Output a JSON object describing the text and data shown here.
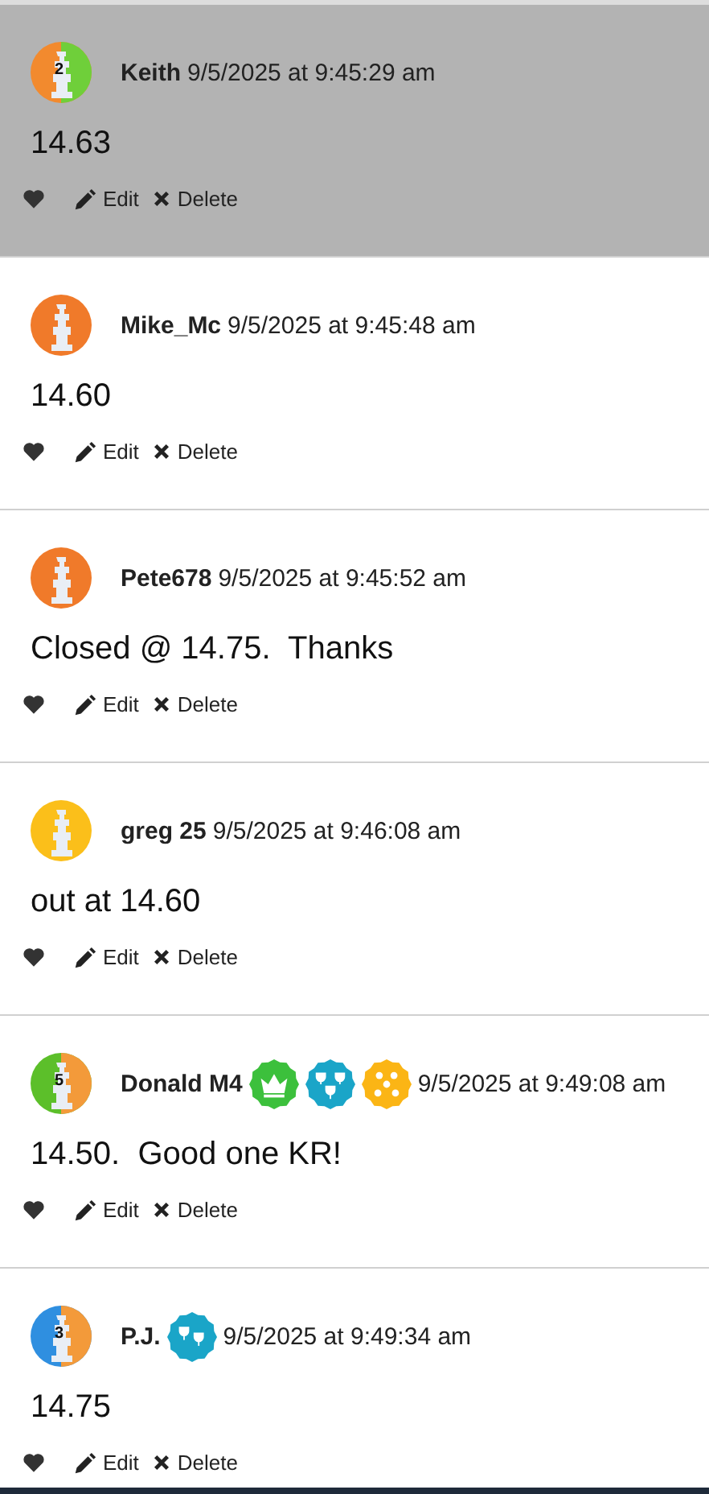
{
  "comments": [
    {
      "author": "Keith",
      "timestamp": "9/5/2025 at 9:45:29 am",
      "text": "14.63",
      "highlighted": true,
      "avatar": {
        "kind": "greensplit",
        "rank": "2",
        "color": "#f28a2e"
      },
      "actions": {
        "edit": "Edit",
        "delete": "Delete"
      }
    },
    {
      "author": "Mike_Mc",
      "timestamp": "9/5/2025 at 9:45:48 am",
      "text": "14.60",
      "highlighted": false,
      "avatar": {
        "kind": "plain",
        "color": "#f07a2a"
      },
      "actions": {
        "edit": "Edit",
        "delete": "Delete"
      }
    },
    {
      "author": "Pete678",
      "timestamp": "9/5/2025 at 9:45:52 am",
      "text": "Closed @ 14.75.  Thanks",
      "highlighted": false,
      "avatar": {
        "kind": "plain",
        "color": "#f07a2a"
      },
      "actions": {
        "edit": "Edit",
        "delete": "Delete"
      }
    },
    {
      "author": "greg 25",
      "timestamp": "9/5/2025 at 9:46:08 am",
      "text": "out at 14.60",
      "highlighted": false,
      "avatar": {
        "kind": "plain",
        "color": "#fbbf1a"
      },
      "actions": {
        "edit": "Edit",
        "delete": "Delete"
      }
    },
    {
      "author": "Donald M4",
      "timestamp": "9/5/2025 at 9:49:08 am",
      "text": "14.50.  Good one KR!",
      "highlighted": false,
      "avatar": {
        "kind": "orangesplit",
        "rank": "5",
        "color": "#5cbf2a"
      },
      "badges": [
        {
          "kind": "crown",
          "color": "#3cc03c"
        },
        {
          "kind": "trophies3",
          "color": "#1aa5c8"
        },
        {
          "kind": "stars",
          "color": "#fbb515"
        }
      ],
      "actions": {
        "edit": "Edit",
        "delete": "Delete"
      }
    },
    {
      "author": "P.J.",
      "timestamp": "9/5/2025 at 9:49:34 am",
      "text": "14.75",
      "highlighted": false,
      "avatar": {
        "kind": "orangesplit",
        "rank": "3",
        "color": "#2f8fe0"
      },
      "badges": [
        {
          "kind": "trophies2",
          "color": "#1aa5c8"
        }
      ],
      "actions": {
        "edit": "Edit",
        "delete": "Delete"
      }
    }
  ]
}
